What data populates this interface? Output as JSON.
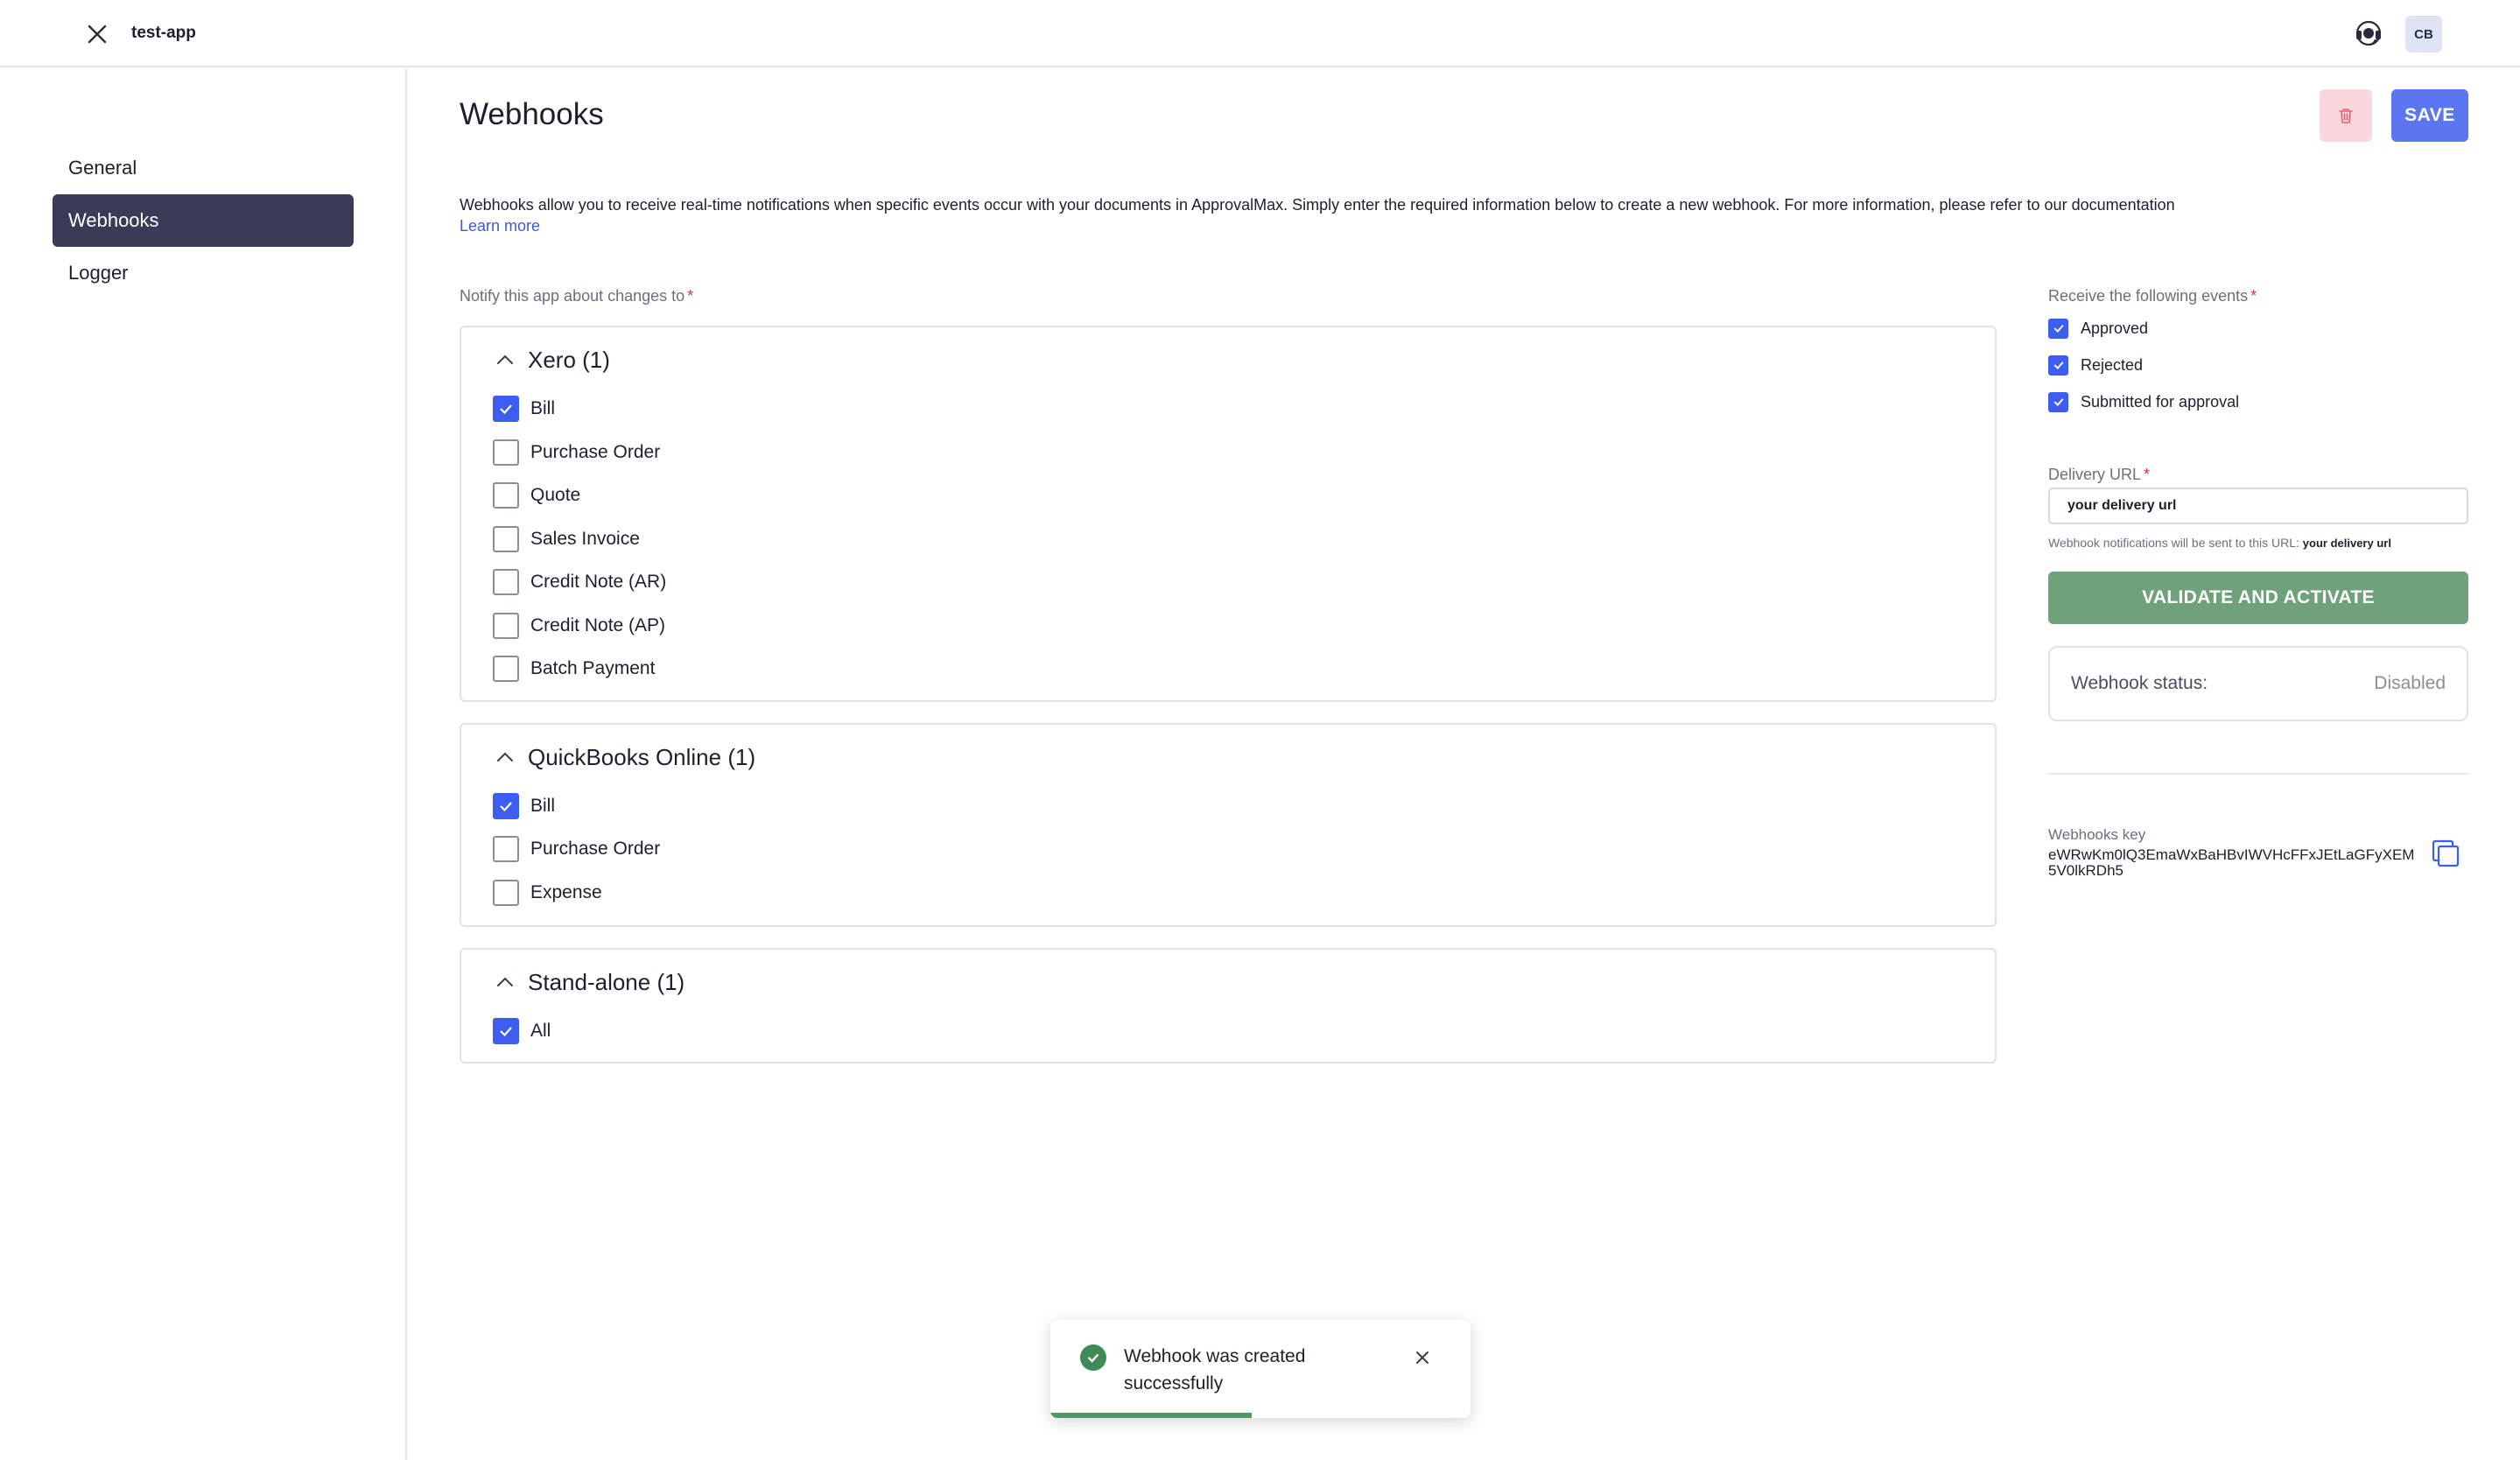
{
  "header": {
    "app_name": "test-app",
    "avatar_initials": "CB",
    "close_icon": "close-icon",
    "support_icon": "headset-icon"
  },
  "sidebar": {
    "items": [
      {
        "label": "General",
        "active": false
      },
      {
        "label": "Webhooks",
        "active": true
      },
      {
        "label": "Logger",
        "active": false
      }
    ]
  },
  "main": {
    "title": "Webhooks",
    "save_label": "SAVE",
    "delete_icon": "trash-icon",
    "description": "Webhooks allow you to receive real-time notifications when specific events occur with your documents in ApprovalMax. Simply enter the required information below to create a new webhook. For more information, please refer to our documentation",
    "learn_more": "Learn more",
    "notify_label": "Notify this app about changes to",
    "required_mark": "*",
    "groups": [
      {
        "title": "Xero (1)",
        "items": [
          {
            "label": "Bill",
            "checked": true
          },
          {
            "label": "Purchase Order",
            "checked": false
          },
          {
            "label": "Quote",
            "checked": false
          },
          {
            "label": "Sales Invoice",
            "checked": false
          },
          {
            "label": "Credit Note (AR)",
            "checked": false
          },
          {
            "label": "Credit Note (AP)",
            "checked": false
          },
          {
            "label": "Batch Payment",
            "checked": false
          }
        ]
      },
      {
        "title": "QuickBooks Online (1)",
        "items": [
          {
            "label": "Bill",
            "checked": true
          },
          {
            "label": "Purchase Order",
            "checked": false
          },
          {
            "label": "Expense",
            "checked": false
          }
        ]
      },
      {
        "title": "Stand-alone (1)",
        "items": [
          {
            "label": "All",
            "checked": true
          }
        ]
      }
    ]
  },
  "panel": {
    "events_label": "Receive the following events",
    "events": [
      {
        "label": "Approved",
        "checked": true
      },
      {
        "label": "Rejected",
        "checked": true
      },
      {
        "label": "Submitted for approval",
        "checked": true
      }
    ],
    "url_label": "Delivery URL",
    "url_value": "your delivery url",
    "url_hint_prefix": "Webhook notifications will be sent to this URL:",
    "url_hint_value": "your delivery url",
    "validate_label": "VALIDATE AND ACTIVATE",
    "status_label": "Webhook status:",
    "status_value": "Disabled",
    "key_label": "Webhooks key",
    "key_value": "eWRwKm0lQ3EmaWxBaHBvIWVHcFFxJEtLaGFyXEM5V0lkRDh5",
    "copy_icon": "copy-icon"
  },
  "toast": {
    "message": "Webhook was created successfully",
    "progress": 0.48,
    "icon": "check-circle-icon"
  },
  "colors": {
    "accent": "#3d5cf0",
    "sidebar_active": "#393b57",
    "validate": "#6fa27a",
    "danger_soft": "#f8d8dd"
  }
}
